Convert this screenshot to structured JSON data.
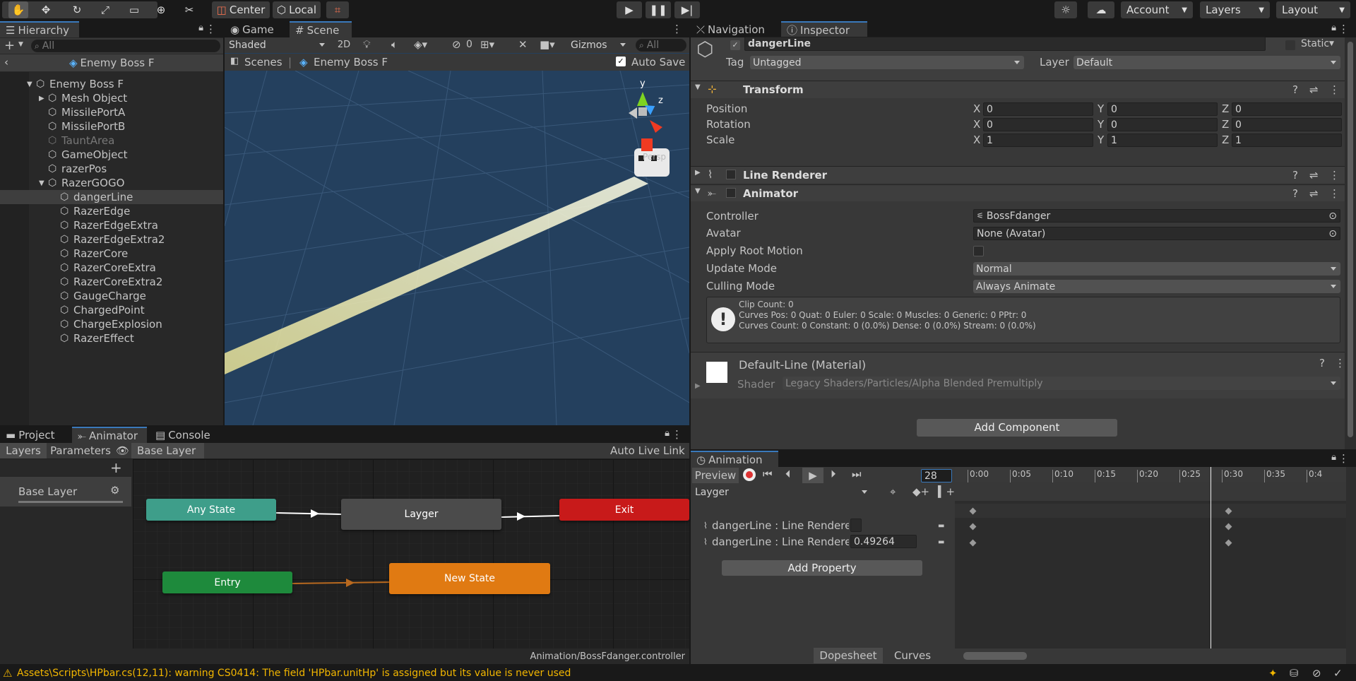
{
  "toolbar": {
    "pivot": "Center",
    "space": "Local",
    "account": "Account",
    "layers": "Layers",
    "layout": "Layout"
  },
  "hierarchy": {
    "tab": "Hierarchy",
    "search_placeholder": "All",
    "scene": "Enemy Boss F",
    "items": [
      {
        "label": "Enemy Boss F",
        "indent": 0,
        "arrow": "open"
      },
      {
        "label": "Mesh Object",
        "indent": 1,
        "arrow": "closed"
      },
      {
        "label": "MissilePortA",
        "indent": 1,
        "arrow": ""
      },
      {
        "label": "MissilePortB",
        "indent": 1,
        "arrow": ""
      },
      {
        "label": "TauntArea",
        "indent": 1,
        "arrow": "",
        "dim": true
      },
      {
        "label": "GameObject",
        "indent": 1,
        "arrow": ""
      },
      {
        "label": "razerPos",
        "indent": 1,
        "arrow": ""
      },
      {
        "label": "RazerGOGO",
        "indent": 1,
        "arrow": "open"
      },
      {
        "label": "dangerLine",
        "indent": 2,
        "arrow": "",
        "selected": true
      },
      {
        "label": "RazerEdge",
        "indent": 2,
        "arrow": ""
      },
      {
        "label": "RazerEdgeExtra",
        "indent": 2,
        "arrow": ""
      },
      {
        "label": "RazerEdgeExtra2",
        "indent": 2,
        "arrow": ""
      },
      {
        "label": "RazerCore",
        "indent": 2,
        "arrow": ""
      },
      {
        "label": "RazerCoreExtra",
        "indent": 2,
        "arrow": ""
      },
      {
        "label": "RazerCoreExtra2",
        "indent": 2,
        "arrow": ""
      },
      {
        "label": "GaugeCharge",
        "indent": 2,
        "arrow": ""
      },
      {
        "label": "ChargedPoint",
        "indent": 2,
        "arrow": ""
      },
      {
        "label": "ChargeExplosion",
        "indent": 2,
        "arrow": ""
      },
      {
        "label": "RazerEffect",
        "indent": 2,
        "arrow": ""
      }
    ]
  },
  "scene": {
    "tab_game": "Game",
    "tab_scene": "Scene",
    "shading": "Shaded",
    "mode2d": "2D",
    "hidden_count": "0",
    "gizmos": "Gizmos",
    "search_placeholder": "All",
    "breadcrumb_root": "Scenes",
    "breadcrumb_prefab": "Enemy Boss F",
    "autosave": "Auto Save",
    "axis_y": "y",
    "axis_z": "z",
    "persp": "Persp"
  },
  "inspector": {
    "tab_nav": "Navigation",
    "tab_inspector": "Inspector",
    "object_name": "dangerLine",
    "static": "Static",
    "tag_label": "Tag",
    "tag_value": "Untagged",
    "layer_label": "Layer",
    "layer_value": "Default",
    "transform": {
      "title": "Transform",
      "position": "Position",
      "rotation": "Rotation",
      "scale": "Scale",
      "pos": [
        "0",
        "0",
        "0"
      ],
      "rot": [
        "0",
        "0",
        "0"
      ],
      "scl": [
        "1",
        "1",
        "1"
      ],
      "x": "X",
      "y": "Y",
      "z": "Z"
    },
    "line_renderer": "Line Renderer",
    "animator": {
      "title": "Animator",
      "controller_label": "Controller",
      "controller_value": "BossFdanger",
      "avatar_label": "Avatar",
      "avatar_value": "None (Avatar)",
      "root_motion": "Apply Root Motion",
      "update_label": "Update Mode",
      "update_value": "Normal",
      "culling_label": "Culling Mode",
      "culling_value": "Always Animate",
      "info1": "Clip Count: 0",
      "info2": "Curves Pos: 0 Quat: 0 Euler: 0 Scale: 0 Muscles: 0 Generic: 0 PPtr: 0",
      "info3": "Curves Count: 0 Constant: 0 (0.0%) Dense: 0 (0.0%) Stream: 0 (0.0%)"
    },
    "material": {
      "name": "Default-Line (Material)",
      "shader_label": "Shader",
      "shader_value": "Legacy Shaders/Particles/Alpha Blended Premultiply"
    },
    "add_component": "Add Component"
  },
  "animator_panel": {
    "tab_project": "Project",
    "tab_animator": "Animator",
    "tab_console": "Console",
    "layers": "Layers",
    "parameters": "Parameters",
    "breadcrumb": "Base Layer",
    "live_link": "Auto Live Link",
    "layer_name": "Base Layer",
    "footer": "Animation/BossFdanger.controller",
    "nodes": {
      "any": "Any State",
      "layger": "Layger",
      "exit": "Exit",
      "entry": "Entry",
      "new_state": "New State"
    }
  },
  "animation_panel": {
    "tab": "Animation",
    "preview": "Preview",
    "frame": "28",
    "clip": "Layger",
    "ticks": [
      "0:00",
      "0:05",
      "0:10",
      "0:15",
      "0:20",
      "0:25",
      "0:30",
      "0:35",
      "0:4"
    ],
    "props": [
      {
        "label": "dangerLine : Line Renderer.Er",
        "value": ""
      },
      {
        "label": "dangerLine : Line Renderer.P.",
        "value": "0.49264"
      }
    ],
    "add_property": "Add Property",
    "dopesheet": "Dopesheet",
    "curves": "Curves"
  },
  "status": {
    "warning": "Assets\\Scripts\\HPbar.cs(12,11): warning CS0414: The field 'HPbar.unitHp' is assigned but its value is never used"
  },
  "colors": {
    "accent": "#3a79bb",
    "any_state": "#3e9e8a",
    "entry": "#1e8a3c",
    "exit": "#c81a1a",
    "new_state": "#e07a12",
    "scene_bg": "#24405e",
    "warning": "#f2b600"
  }
}
